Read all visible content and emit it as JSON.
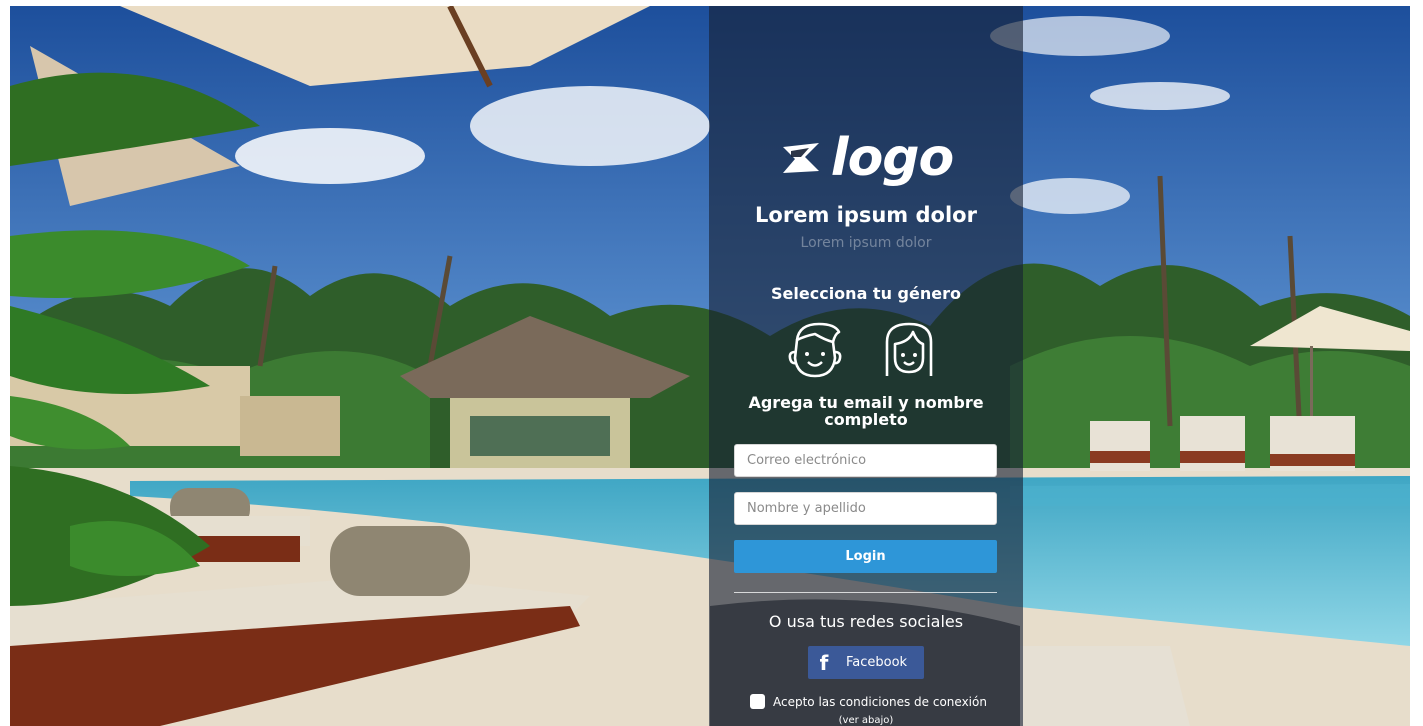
{
  "brand": {
    "logo_text": "logo"
  },
  "header": {
    "title": "Lorem ipsum dolor",
    "subtitle": "Lorem ipsum dolor"
  },
  "gender": {
    "heading": "Selecciona tu género",
    "options": [
      "male-face-icon",
      "female-face-icon"
    ]
  },
  "form": {
    "heading": "Agrega tu email y nombre completo",
    "email_placeholder": "Correo electrónico",
    "email_value": "",
    "name_placeholder": "Nombre y apellido",
    "name_value": "",
    "login_label": "Login"
  },
  "social": {
    "heading": "O usa tus redes sociales",
    "facebook_icon": "f",
    "facebook_label": "Facebook"
  },
  "terms": {
    "label": "Acepto las condiciones de conexión",
    "note": "(ver abajo)",
    "checked": false
  },
  "colors": {
    "accent": "#2e96d8",
    "facebook": "#3b5998",
    "panel": "#162034"
  }
}
